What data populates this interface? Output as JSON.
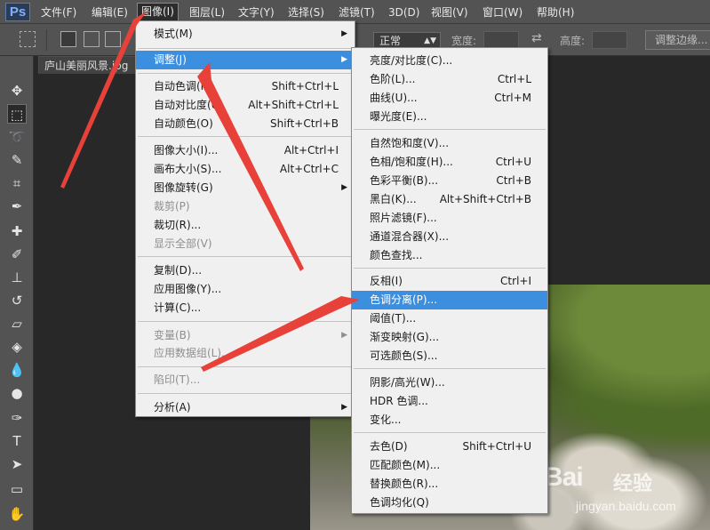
{
  "app": {
    "logo": "Ps"
  },
  "menubar": {
    "items": [
      {
        "label": "文件(F)"
      },
      {
        "label": "编辑(E)"
      },
      {
        "label": "图像(I)"
      },
      {
        "label": "图层(L)"
      },
      {
        "label": "文字(Y)"
      },
      {
        "label": "选择(S)"
      },
      {
        "label": "滤镜(T)"
      },
      {
        "label": "3D(D)"
      },
      {
        "label": "视图(V)"
      },
      {
        "label": "窗口(W)"
      },
      {
        "label": "帮助(H)"
      }
    ]
  },
  "options": {
    "style_value": "正常",
    "width_label": "宽度:",
    "height_label": "高度:",
    "refine_label": "调整边缘..."
  },
  "document": {
    "tab_title": "庐山美丽风景.jpg"
  },
  "image_menu": {
    "items": [
      {
        "label": "模式(M)",
        "submenu": true
      },
      {
        "label": "调整(J)",
        "submenu": true,
        "highlight": true
      },
      {
        "label": "自动色调(N)",
        "shortcut": "Shift+Ctrl+L"
      },
      {
        "label": "自动对比度(U)",
        "shortcut": "Alt+Shift+Ctrl+L"
      },
      {
        "label": "自动颜色(O)",
        "shortcut": "Shift+Ctrl+B"
      },
      {
        "label": "图像大小(I)...",
        "shortcut": "Alt+Ctrl+I"
      },
      {
        "label": "画布大小(S)...",
        "shortcut": "Alt+Ctrl+C"
      },
      {
        "label": "图像旋转(G)",
        "submenu": true
      },
      {
        "label": "裁剪(P)",
        "disabled": true
      },
      {
        "label": "裁切(R)..."
      },
      {
        "label": "显示全部(V)",
        "disabled": true
      },
      {
        "label": "复制(D)..."
      },
      {
        "label": "应用图像(Y)..."
      },
      {
        "label": "计算(C)..."
      },
      {
        "label": "变量(B)",
        "submenu": true,
        "disabled": true
      },
      {
        "label": "应用数据组(L)...",
        "disabled": true
      },
      {
        "label": "陷印(T)...",
        "disabled": true
      },
      {
        "label": "分析(A)",
        "submenu": true
      }
    ]
  },
  "adjust_menu": {
    "items": [
      {
        "label": "亮度/对比度(C)..."
      },
      {
        "label": "色阶(L)...",
        "shortcut": "Ctrl+L"
      },
      {
        "label": "曲线(U)...",
        "shortcut": "Ctrl+M"
      },
      {
        "label": "曝光度(E)..."
      },
      {
        "label": "自然饱和度(V)..."
      },
      {
        "label": "色相/饱和度(H)...",
        "shortcut": "Ctrl+U"
      },
      {
        "label": "色彩平衡(B)...",
        "shortcut": "Ctrl+B"
      },
      {
        "label": "黑白(K)...",
        "shortcut": "Alt+Shift+Ctrl+B"
      },
      {
        "label": "照片滤镜(F)..."
      },
      {
        "label": "通道混合器(X)..."
      },
      {
        "label": "颜色查找..."
      },
      {
        "label": "反相(I)",
        "shortcut": "Ctrl+I"
      },
      {
        "label": "色调分离(P)...",
        "highlight": true
      },
      {
        "label": "阈值(T)..."
      },
      {
        "label": "渐变映射(G)..."
      },
      {
        "label": "可选颜色(S)..."
      },
      {
        "label": "阴影/高光(W)..."
      },
      {
        "label": "HDR 色调..."
      },
      {
        "label": "变化..."
      },
      {
        "label": "去色(D)",
        "shortcut": "Shift+Ctrl+U"
      },
      {
        "label": "匹配颜色(M)..."
      },
      {
        "label": "替换颜色(R)..."
      },
      {
        "label": "色调均化(Q)"
      }
    ]
  },
  "watermark": {
    "logo": "Bai",
    "text": "经验",
    "url": "jingyan.baidu.com"
  },
  "colors": {
    "highlight": "#3c8ede",
    "arrow": "#e8413a",
    "menu_bg": "#f0f0f0",
    "chrome": "#535353"
  }
}
